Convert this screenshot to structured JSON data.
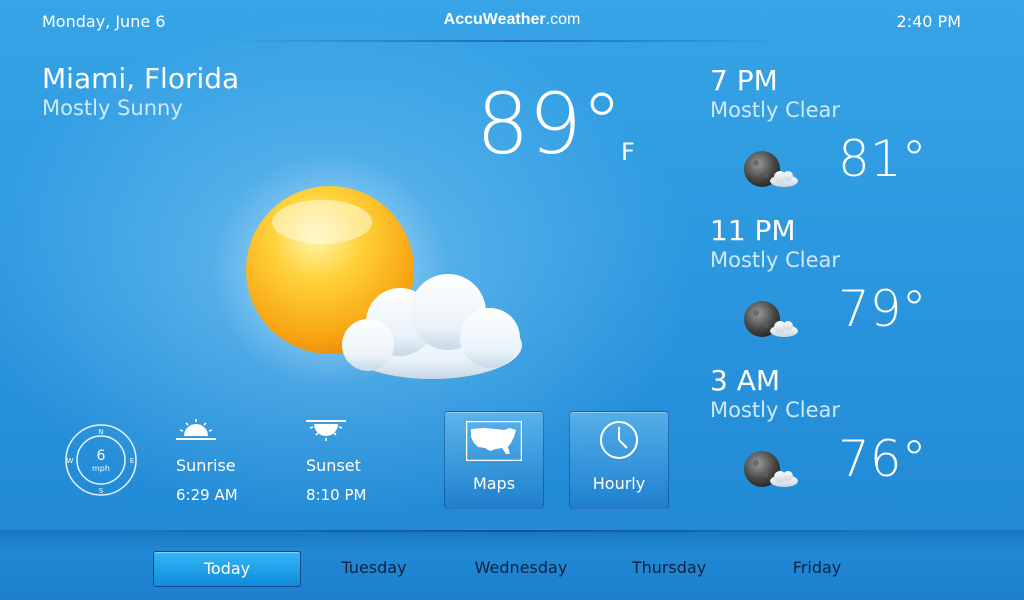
{
  "header": {
    "date": "Monday, June 6",
    "brand_bold": "AccuWeather",
    "brand_suffix": ".com",
    "time": "2:40 PM"
  },
  "current": {
    "location": "Miami, Florida",
    "condition": "Mostly Sunny",
    "temperature": "89°",
    "unit": "F",
    "icon": "sun-cloud-icon"
  },
  "wind": {
    "speed": "6",
    "unit": "mph",
    "directions": {
      "n": "N",
      "e": "E",
      "s": "S",
      "w": "W"
    }
  },
  "sun": {
    "sunrise_label": "Sunrise",
    "sunrise_time": "6:29 AM",
    "sunset_label": "Sunset",
    "sunset_time": "8:10 PM"
  },
  "buttons": {
    "maps": "Maps",
    "hourly": "Hourly"
  },
  "forecast": [
    {
      "time": "7 PM",
      "condition": "Mostly Clear",
      "temp": "81°",
      "icon": "moon-cloud-icon"
    },
    {
      "time": "11 PM",
      "condition": "Mostly Clear",
      "temp": "79°",
      "icon": "moon-cloud-icon"
    },
    {
      "time": "3 AM",
      "condition": "Mostly Clear",
      "temp": "76°",
      "icon": "moon-cloud-icon"
    }
  ],
  "tabs": [
    {
      "label": "Today",
      "active": true
    },
    {
      "label": "Tuesday",
      "active": false
    },
    {
      "label": "Wednesday",
      "active": false
    },
    {
      "label": "Thursday",
      "active": false
    },
    {
      "label": "Friday",
      "active": false
    }
  ],
  "colors": {
    "background": "#2b97df",
    "active_tab": "#118bdb",
    "sun": "#f9b81a",
    "tab_text": "#0b2340"
  }
}
